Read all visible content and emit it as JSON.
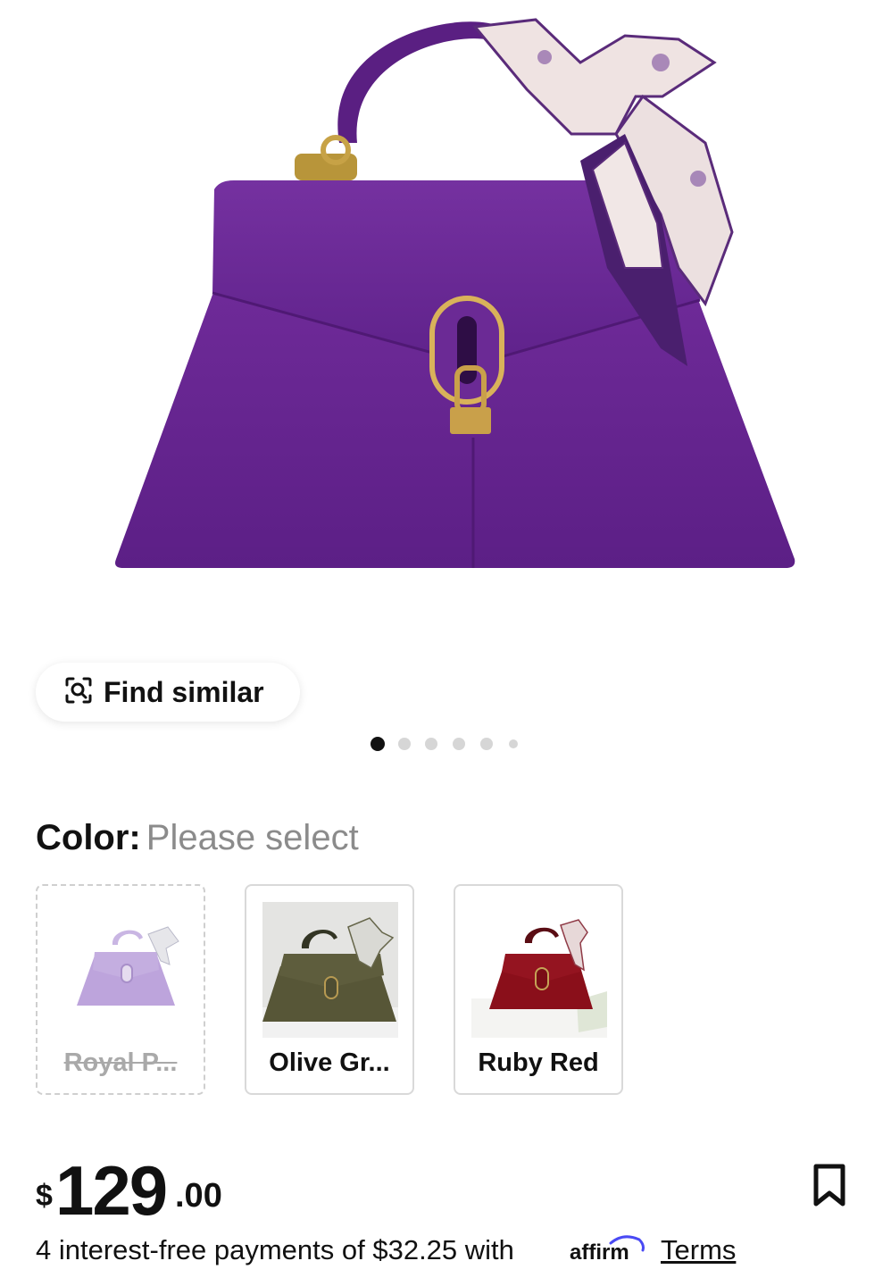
{
  "product": {
    "image_alt": "Purple suede top-handle bag with scarf",
    "gallery": {
      "count": 6,
      "active_index": 0
    }
  },
  "find_similar": {
    "label": "Find similar",
    "icon": "image-search-icon"
  },
  "color": {
    "label": "Color:",
    "value": "Please select",
    "options": [
      {
        "name": "Royal  P...",
        "available": false
      },
      {
        "name": "Olive Gr...",
        "available": true
      },
      {
        "name": "Ruby Red",
        "available": true
      }
    ]
  },
  "price": {
    "currency": "$",
    "integer": "129",
    "decimal": ".00"
  },
  "payments": {
    "text": "4 interest-free payments of $32.25 with",
    "provider": "affirm",
    "terms": "Terms"
  },
  "colors": {
    "purple": "#6a2596",
    "olive": "#575637",
    "ruby": "#8a0f1a",
    "lavender": "#bda4dc"
  }
}
